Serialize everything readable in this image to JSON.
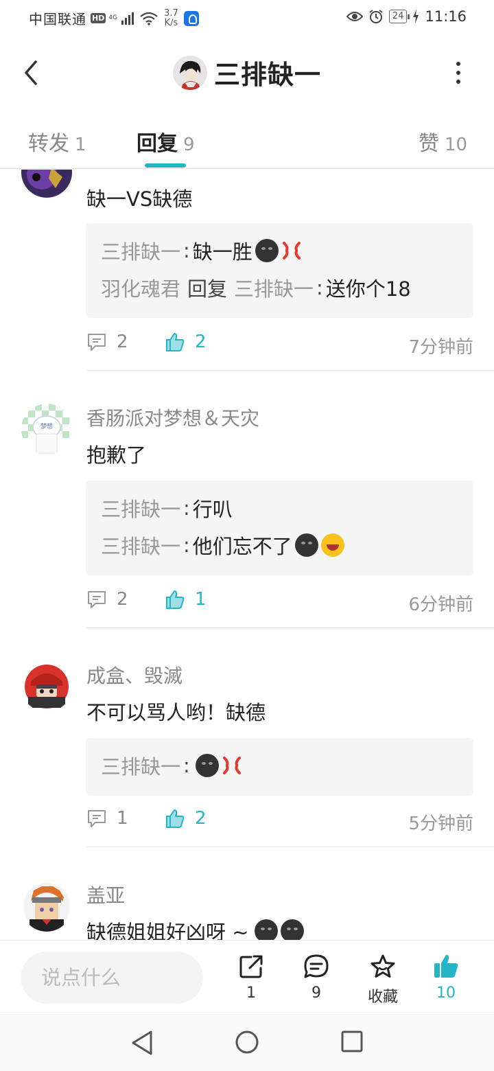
{
  "status_bar": {
    "carrier": "中国联通",
    "hd": "HD",
    "network": "4G",
    "speed_value": "3.7",
    "speed_unit": "K/s",
    "battery": "24",
    "time": "11:16"
  },
  "header": {
    "title": "三排缺一"
  },
  "tabs": [
    {
      "label": "转发",
      "count": "1"
    },
    {
      "label": "回复",
      "count": "9"
    },
    {
      "label": "赞",
      "count": "10"
    }
  ],
  "comments": [
    {
      "username": "",
      "content": "缺一VS缺德",
      "quotes": [
        {
          "name": "三排缺一",
          "sep": ":",
          "text": "缺一胜",
          "emojis": [
            "dark-face",
            "anger"
          ]
        },
        {
          "name": "羽化魂君",
          "reply": "回复",
          "name2": "三排缺一",
          "sep": ":",
          "text": "送你个18",
          "emojis": []
        }
      ],
      "reply_count": "2",
      "like_count": "2",
      "time": "7分钟前"
    },
    {
      "username": "香肠派对梦想＆天灾",
      "content": "抱歉了",
      "quotes": [
        {
          "name": "三排缺一",
          "sep": ":",
          "text": "行叭",
          "emojis": []
        },
        {
          "name": "三排缺一",
          "sep": ":",
          "text": "他们忘不了",
          "emojis": [
            "dark-face",
            "laugh-cry"
          ]
        }
      ],
      "reply_count": "2",
      "like_count": "1",
      "time": "6分钟前"
    },
    {
      "username": "成盒、毁滅",
      "content": "不可以骂人哟！缺德",
      "quotes": [
        {
          "name": "三排缺一",
          "sep": ":",
          "text": "",
          "emojis": [
            "dark-face",
            "anger"
          ]
        }
      ],
      "reply_count": "1",
      "like_count": "2",
      "time": "5分钟前"
    },
    {
      "username": "盖亚",
      "content": "缺德姐姐好凶呀 ~",
      "content_emojis": [
        "dark-face",
        "dark-face"
      ]
    }
  ],
  "bottom_bar": {
    "input_placeholder": "说点什么",
    "share_count": "1",
    "comment_count": "9",
    "favorite_label": "收藏",
    "like_count": "10"
  },
  "colors": {
    "accent": "#23b5c5",
    "muted_text": "#888888",
    "quote_bg": "#f5f5f5"
  }
}
